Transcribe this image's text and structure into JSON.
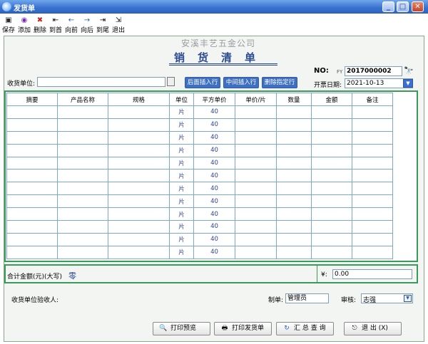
{
  "window": {
    "title": "发货单",
    "controls": [
      "_",
      "□",
      "✕"
    ]
  },
  "toolbar": {
    "items": [
      {
        "label": "保存",
        "icon": "save-icon",
        "glyph": "▣",
        "color": "#2a2a2a"
      },
      {
        "label": "添加",
        "icon": "add-icon",
        "glyph": "◉",
        "color": "#7a2ab0"
      },
      {
        "label": "删除",
        "icon": "delete-icon",
        "glyph": "✖",
        "color": "#c8201c"
      },
      {
        "label": "到首",
        "icon": "first-icon",
        "glyph": "⇤",
        "color": "#333333"
      },
      {
        "label": "向前",
        "icon": "prev-icon",
        "glyph": "←",
        "color": "#1f5ecc"
      },
      {
        "label": "向后",
        "icon": "next-icon",
        "glyph": "→",
        "color": "#1f5ecc"
      },
      {
        "label": "到尾",
        "icon": "last-icon",
        "glyph": "⇥",
        "color": "#333333"
      },
      {
        "label": "退出",
        "icon": "exit-icon",
        "glyph": "⇲",
        "color": "#333333"
      }
    ]
  },
  "header": {
    "company": "安溪丰艺五金公司",
    "title": "销货清单",
    "no_label": "NO:",
    "no_prefix": "FY",
    "no_value": "2017000002",
    "date_label": "开票日期:",
    "date_value": "2021-10-13",
    "receiver_label": "收货单位:",
    "receiver_value": "",
    "buttons": {
      "insert_after": "后面插入行",
      "insert_middle": "中间插入行",
      "delete_row": "删除指定行"
    }
  },
  "table": {
    "columns": [
      "摘要",
      "产品名称",
      "规格",
      "单位",
      "平方单价",
      "单价/片",
      "数量",
      "金额",
      "备注"
    ],
    "rows": [
      [
        "",
        "",
        "",
        "片",
        "40",
        "",
        "",
        "",
        ""
      ],
      [
        "",
        "",
        "",
        "片",
        "40",
        "",
        "",
        "",
        ""
      ],
      [
        "",
        "",
        "",
        "片",
        "40",
        "",
        "",
        "",
        ""
      ],
      [
        "",
        "",
        "",
        "片",
        "40",
        "",
        "",
        "",
        ""
      ],
      [
        "",
        "",
        "",
        "片",
        "40",
        "",
        "",
        "",
        ""
      ],
      [
        "",
        "",
        "",
        "片",
        "40",
        "",
        "",
        "",
        ""
      ],
      [
        "",
        "",
        "",
        "片",
        "40",
        "",
        "",
        "",
        ""
      ],
      [
        "",
        "",
        "",
        "片",
        "40",
        "",
        "",
        "",
        ""
      ],
      [
        "",
        "",
        "",
        "片",
        "40",
        "",
        "",
        "",
        ""
      ],
      [
        "",
        "",
        "",
        "片",
        "40",
        "",
        "",
        "",
        ""
      ],
      [
        "",
        "",
        "",
        "片",
        "40",
        "",
        "",
        "",
        ""
      ],
      [
        "",
        "",
        "",
        "片",
        "40",
        "",
        "",
        "",
        ""
      ]
    ]
  },
  "summary": {
    "total_label": "合计金额(元)(大写)",
    "total_words": "零",
    "currency_label": "¥:",
    "total_value": "0.00"
  },
  "footer": {
    "acceptor_label": "收货单位验收人:",
    "maker_label": "制单:",
    "maker_value": "管理员",
    "auditor_label": "审核:",
    "auditor_value": "志强",
    "buttons": {
      "print_preview": "打印预览",
      "print_invoice": "打印发货单",
      "summary_query": "汇 总 查 询",
      "exit": "退 出 (X)"
    }
  },
  "colors": {
    "title_blue": "#2b4a8f",
    "grid_green": "#3a9a5a",
    "unit_blue": "#2b3f9a"
  }
}
